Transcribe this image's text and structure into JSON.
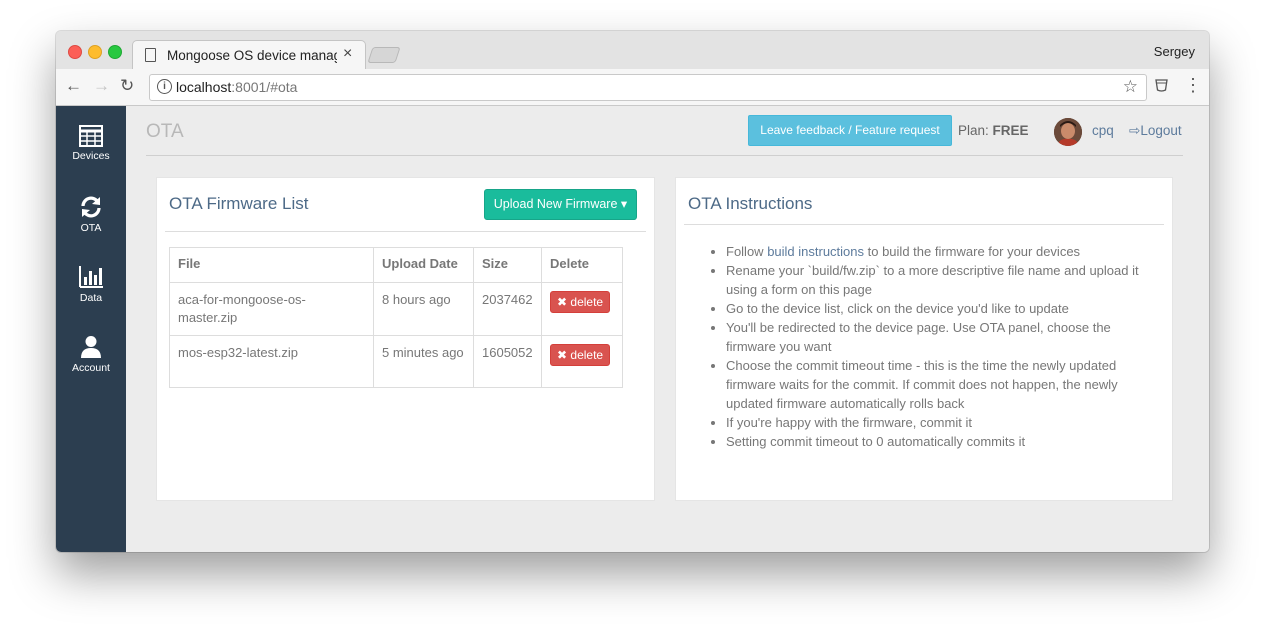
{
  "browser": {
    "tab_title": "Mongoose OS device manage",
    "profile_name": "Sergey",
    "url_host": "localhost",
    "url_rest": ":8001/#ota"
  },
  "sidebar": {
    "items": [
      {
        "label": "Devices",
        "icon": "grid-icon"
      },
      {
        "label": "OTA",
        "icon": "refresh-icon"
      },
      {
        "label": "Data",
        "icon": "bar-chart-icon"
      },
      {
        "label": "Account",
        "icon": "user-icon"
      }
    ]
  },
  "header": {
    "page_title": "OTA",
    "feedback_label": "Leave feedback / Feature request",
    "plan_label": "Plan:",
    "plan_value": "FREE",
    "username": "cpq",
    "logout_label": "Logout"
  },
  "firmware_panel": {
    "title": "OTA Firmware List",
    "upload_label": "Upload New Firmware",
    "columns": [
      "File",
      "Upload Date",
      "Size",
      "Delete"
    ],
    "rows": [
      {
        "file": "aca-for-mongoose-os-master.zip",
        "date": "8 hours ago",
        "size": "2037462",
        "delete_label": "delete"
      },
      {
        "file": "mos-esp32-latest.zip",
        "date": "5 minutes ago",
        "size": "1605052",
        "delete_label": "delete"
      }
    ]
  },
  "instructions_panel": {
    "title": "OTA Instructions",
    "item0_prefix": "Follow ",
    "item0_link": "build instructions",
    "item0_suffix": " to build the firmware for your devices",
    "items": [
      "Rename your `build/fw.zip` to a more descriptive file name and upload it using a form on this page",
      "Go to the device list, click on the device you'd like to update",
      "You'll be redirected to the device page. Use OTA panel, choose the firmware you want",
      "Choose the commit timeout time - this is the time the newly updated firmware waits for the commit. If commit does not happen, the newly updated firmware automatically rolls back",
      "If you're happy with the firmware, commit it",
      "Setting commit timeout to 0 automatically commits it"
    ]
  },
  "colors": {
    "sidebar_bg": "#2c3e50",
    "upload_button": "#1abc9c",
    "feedback_button": "#5bc0de",
    "delete_button": "#d9534f",
    "link": "#5d7b9c"
  }
}
